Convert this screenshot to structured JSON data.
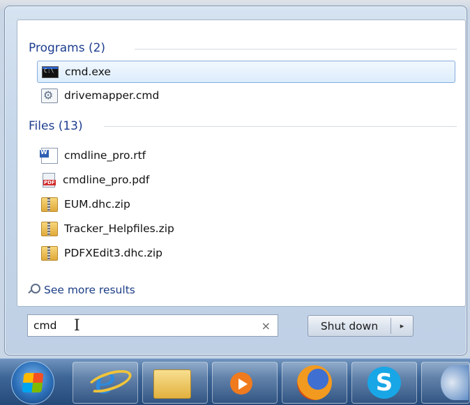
{
  "programs": {
    "header": "Programs (2)",
    "items": [
      {
        "label": "cmd.exe",
        "icon": "cmd-icon",
        "selected": true
      },
      {
        "label": "drivemapper.cmd",
        "icon": "script-icon",
        "selected": false
      }
    ]
  },
  "files": {
    "header": "Files (13)",
    "items": [
      {
        "label": "cmdline_pro.rtf",
        "icon": "rtf-document-icon"
      },
      {
        "label": "cmdline_pro.pdf",
        "icon": "pdf-document-icon"
      },
      {
        "label": "EUM.dhc.zip",
        "icon": "zip-folder-icon"
      },
      {
        "label": "Tracker_Helpfiles.zip",
        "icon": "zip-folder-icon"
      },
      {
        "label": "PDFXEdit3.dhc.zip",
        "icon": "zip-folder-icon"
      }
    ]
  },
  "see_more": "See more results",
  "search": {
    "value": "cmd",
    "clear_glyph": "×"
  },
  "shutdown": {
    "label": "Shut down",
    "arrow": "▸"
  },
  "taskbar": {
    "items": [
      "start-orb",
      "internet-explorer-icon",
      "file-explorer-icon",
      "media-player-icon",
      "firefox-icon",
      "skype-icon",
      "thunderbird-icon"
    ]
  },
  "colors": {
    "header_text": "#1d3d8f",
    "selection_border": "#84acdd",
    "taskbar": "#3d6596"
  }
}
